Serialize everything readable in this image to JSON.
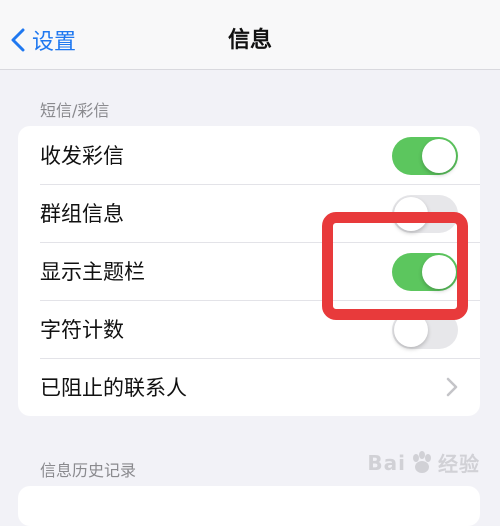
{
  "nav": {
    "back_label": "设置",
    "title": "信息"
  },
  "sections": [
    {
      "header": "短信/彩信",
      "rows": [
        {
          "label": "收发彩信",
          "control": "switch",
          "on": true
        },
        {
          "label": "群组信息",
          "control": "switch",
          "on": false
        },
        {
          "label": "显示主题栏",
          "control": "switch",
          "on": true
        },
        {
          "label": "字符计数",
          "control": "switch",
          "on": false
        },
        {
          "label": "已阻止的联系人",
          "control": "chevron"
        }
      ]
    },
    {
      "header": "信息历史记录"
    }
  ],
  "watermark": {
    "left": "Bai",
    "right": "经验"
  },
  "colors": {
    "accent": "#1f78f0",
    "switch_on": "#5cc65e",
    "switch_off": "#e7e7ea",
    "highlight": "#e83a3b"
  }
}
